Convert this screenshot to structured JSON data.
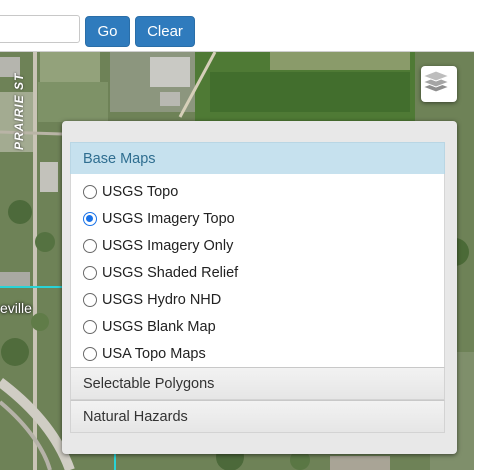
{
  "toolbar": {
    "search_value": "",
    "go_label": "Go",
    "clear_label": "Clear"
  },
  "map": {
    "street_label": "PRAIRIE ST",
    "town_label": "eville",
    "layers_icon": "layers-icon"
  },
  "layer_panel": {
    "base_maps_header": "Base Maps",
    "base_maps": [
      {
        "label": "USGS Topo",
        "selected": false
      },
      {
        "label": "USGS Imagery Topo",
        "selected": true
      },
      {
        "label": "USGS Imagery Only",
        "selected": false
      },
      {
        "label": "USGS Shaded Relief",
        "selected": false
      },
      {
        "label": "USGS Hydro NHD",
        "selected": false
      },
      {
        "label": "USGS Blank Map",
        "selected": false
      },
      {
        "label": "USA Topo Maps",
        "selected": false
      }
    ],
    "selectable_polygons_header": "Selectable Polygons",
    "natural_hazards_header": "Natural Hazards"
  },
  "colors": {
    "button_blue": "#2f7bbd",
    "active_header_bg": "#c6e1ee",
    "active_header_text": "#2f6e90",
    "radio_selected": "#1a73e8",
    "boundary_line": "#29d3d6"
  }
}
